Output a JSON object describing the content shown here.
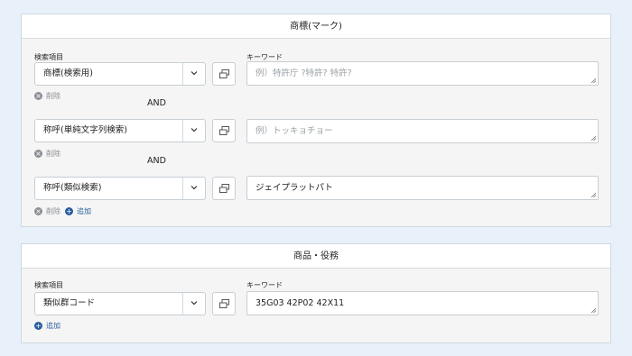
{
  "trademark": {
    "title": "商標(マーク)",
    "field_label": "検索項目",
    "keyword_label": "キーワード",
    "rows": [
      {
        "select": "商標(検索用)",
        "keyword": "",
        "placeholder": "例）特許庁 ?特許? 特許?"
      },
      {
        "select": "称呼(単純文字列検索)",
        "keyword": "",
        "placeholder": "例）トッキョチョー"
      },
      {
        "select": "称呼(類似検索)",
        "keyword": "ジェイプラットパト",
        "placeholder": ""
      }
    ],
    "and_label": "AND",
    "delete_label": "削除",
    "add_label": "追加"
  },
  "goods": {
    "title": "商品・役務",
    "field_label": "検索項目",
    "keyword_label": "キーワード",
    "select": "類似群コード",
    "keyword": "35G03 42P02 42X11",
    "add_label": "追加"
  }
}
